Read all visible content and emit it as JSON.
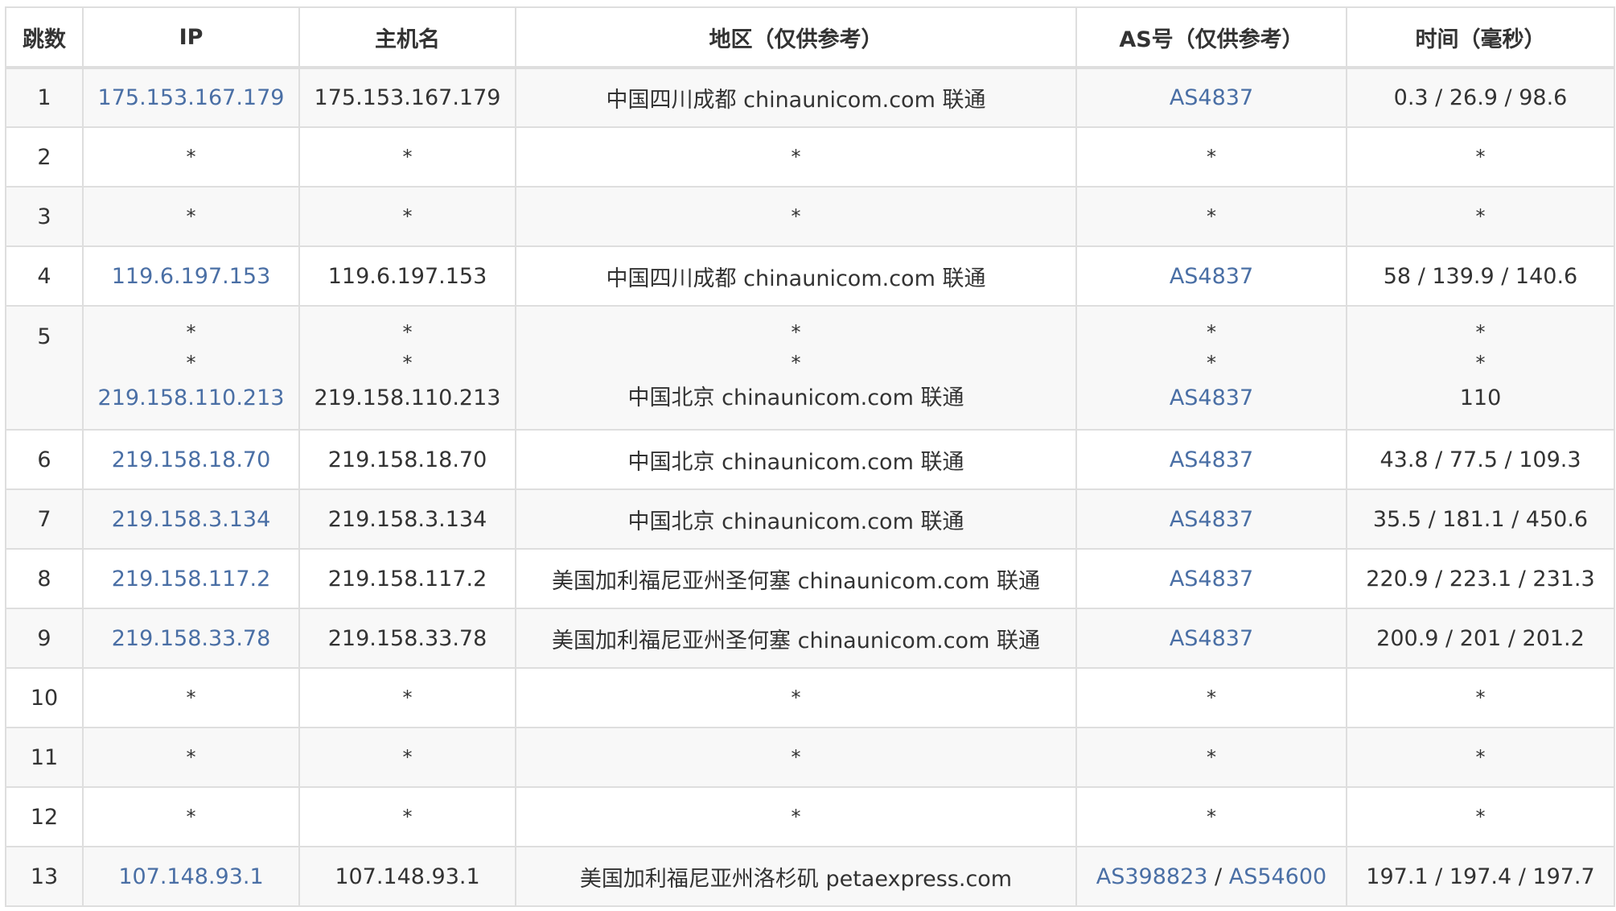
{
  "headers": {
    "hop": "跳数",
    "ip": "IP",
    "hostname": "主机名",
    "region": "地区（仅供参考）",
    "as": "AS号（仅供参考）",
    "time": "时间（毫秒）"
  },
  "rows": [
    {
      "hop": "1",
      "ip": "175.153.167.179",
      "hostname": "175.153.167.179",
      "region": "中国四川成都 chinaunicom.com 联通",
      "as": "AS4837",
      "time": "0.3 / 26.9 / 98.6"
    },
    {
      "hop": "2",
      "ip": "*",
      "hostname": "*",
      "region": "*",
      "as": "*",
      "time": "*"
    },
    {
      "hop": "3",
      "ip": "*",
      "hostname": "*",
      "region": "*",
      "as": "*",
      "time": "*"
    },
    {
      "hop": "4",
      "ip": "119.6.197.153",
      "hostname": "119.6.197.153",
      "region": "中国四川成都 chinaunicom.com 联通",
      "as": "AS4837",
      "time": "58 / 139.9 / 140.6"
    },
    {
      "hop": "5",
      "sub": [
        {
          "ip": "*",
          "hostname": "*",
          "region": "*",
          "as": "*",
          "time": "*"
        },
        {
          "ip": "*",
          "hostname": "*",
          "region": "*",
          "as": "*",
          "time": "*"
        },
        {
          "ip": "219.158.110.213",
          "hostname": "219.158.110.213",
          "region": "中国北京 chinaunicom.com 联通",
          "as": "AS4837",
          "time": "110"
        }
      ]
    },
    {
      "hop": "6",
      "ip": "219.158.18.70",
      "hostname": "219.158.18.70",
      "region": "中国北京 chinaunicom.com 联通",
      "as": "AS4837",
      "time": "43.8 / 77.5 / 109.3"
    },
    {
      "hop": "7",
      "ip": "219.158.3.134",
      "hostname": "219.158.3.134",
      "region": "中国北京 chinaunicom.com 联通",
      "as": "AS4837",
      "time": "35.5 / 181.1 / 450.6"
    },
    {
      "hop": "8",
      "ip": "219.158.117.2",
      "hostname": "219.158.117.2",
      "region": "美国加利福尼亚州圣何塞 chinaunicom.com 联通",
      "as": "AS4837",
      "time": "220.9 / 223.1 / 231.3"
    },
    {
      "hop": "9",
      "ip": "219.158.33.78",
      "hostname": "219.158.33.78",
      "region": "美国加利福尼亚州圣何塞 chinaunicom.com 联通",
      "as": "AS4837",
      "time": "200.9 / 201 / 201.2"
    },
    {
      "hop": "10",
      "ip": "*",
      "hostname": "*",
      "region": "*",
      "as": "*",
      "time": "*"
    },
    {
      "hop": "11",
      "ip": "*",
      "hostname": "*",
      "region": "*",
      "as": "*",
      "time": "*"
    },
    {
      "hop": "12",
      "ip": "*",
      "hostname": "*",
      "region": "*",
      "as": "*",
      "time": "*"
    },
    {
      "hop": "13",
      "ip": "107.148.93.1",
      "hostname": "107.148.93.1",
      "region": "美国加利福尼亚州洛杉矶 petaexpress.com",
      "as": "AS398823",
      "as2": "AS54600",
      "as_sep": " / ",
      "time": "197.1 / 197.4 / 197.7"
    }
  ],
  "colors": {
    "link": "#4a6fa5",
    "border": "#dedede",
    "stripe": "#f8f8f8",
    "text": "#333333"
  }
}
